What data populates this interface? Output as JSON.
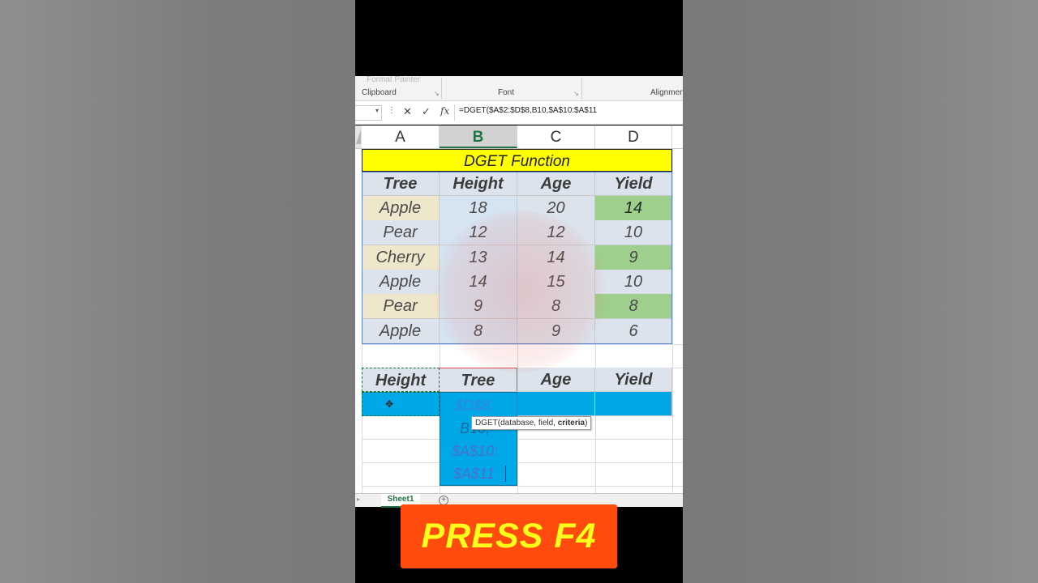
{
  "ribbon": {
    "format_painter": "Format Painter",
    "groups": [
      "Clipboard",
      "Font",
      "Alignmen"
    ]
  },
  "formula_bar": {
    "formula": "=DGET($A$2:$D$8,B10,$A$10:$A$11"
  },
  "columns": [
    "A",
    "B",
    "C",
    "D"
  ],
  "selected_column": "B",
  "sheet": {
    "title": "DGET Function",
    "headers": [
      "Tree",
      "Height",
      "Age",
      "Yield"
    ],
    "rows": [
      [
        "Apple",
        "18",
        "20",
        "14"
      ],
      [
        "Pear",
        "12",
        "12",
        "10"
      ],
      [
        "Cherry",
        "13",
        "14",
        "9"
      ],
      [
        "Apple",
        "14",
        "15",
        "10"
      ],
      [
        "Pear",
        "9",
        "8",
        "8"
      ],
      [
        "Apple",
        "8",
        "9",
        "6"
      ]
    ],
    "criteria_headers": [
      "Height",
      "Tree",
      "Age",
      "Yield"
    ],
    "edit_cell_lines": [
      "$D$8,",
      "B10,",
      "$A$10:",
      "$A$11"
    ]
  },
  "tooltip": {
    "prefix": "DGET(database, field, ",
    "bold": "criteria",
    "suffix": ")"
  },
  "sheet_tab": "Sheet1",
  "banner": "PRESS F4",
  "colors": {
    "title_fill": "#ffff00",
    "header_fill": "#dce3ec",
    "tree_fill_alt": "#efe7cb",
    "tree_fill": "#dce3ec",
    "height_fill": "#d6e4f2",
    "age_fill": "#dce3ec",
    "yield_fill_alt": "#9fcf8d",
    "yield_fill": "#dce3ec",
    "criteria_fill": "#00a8e8",
    "banner_bg": "#ff4c0e",
    "banner_text": "#ffff1c"
  }
}
